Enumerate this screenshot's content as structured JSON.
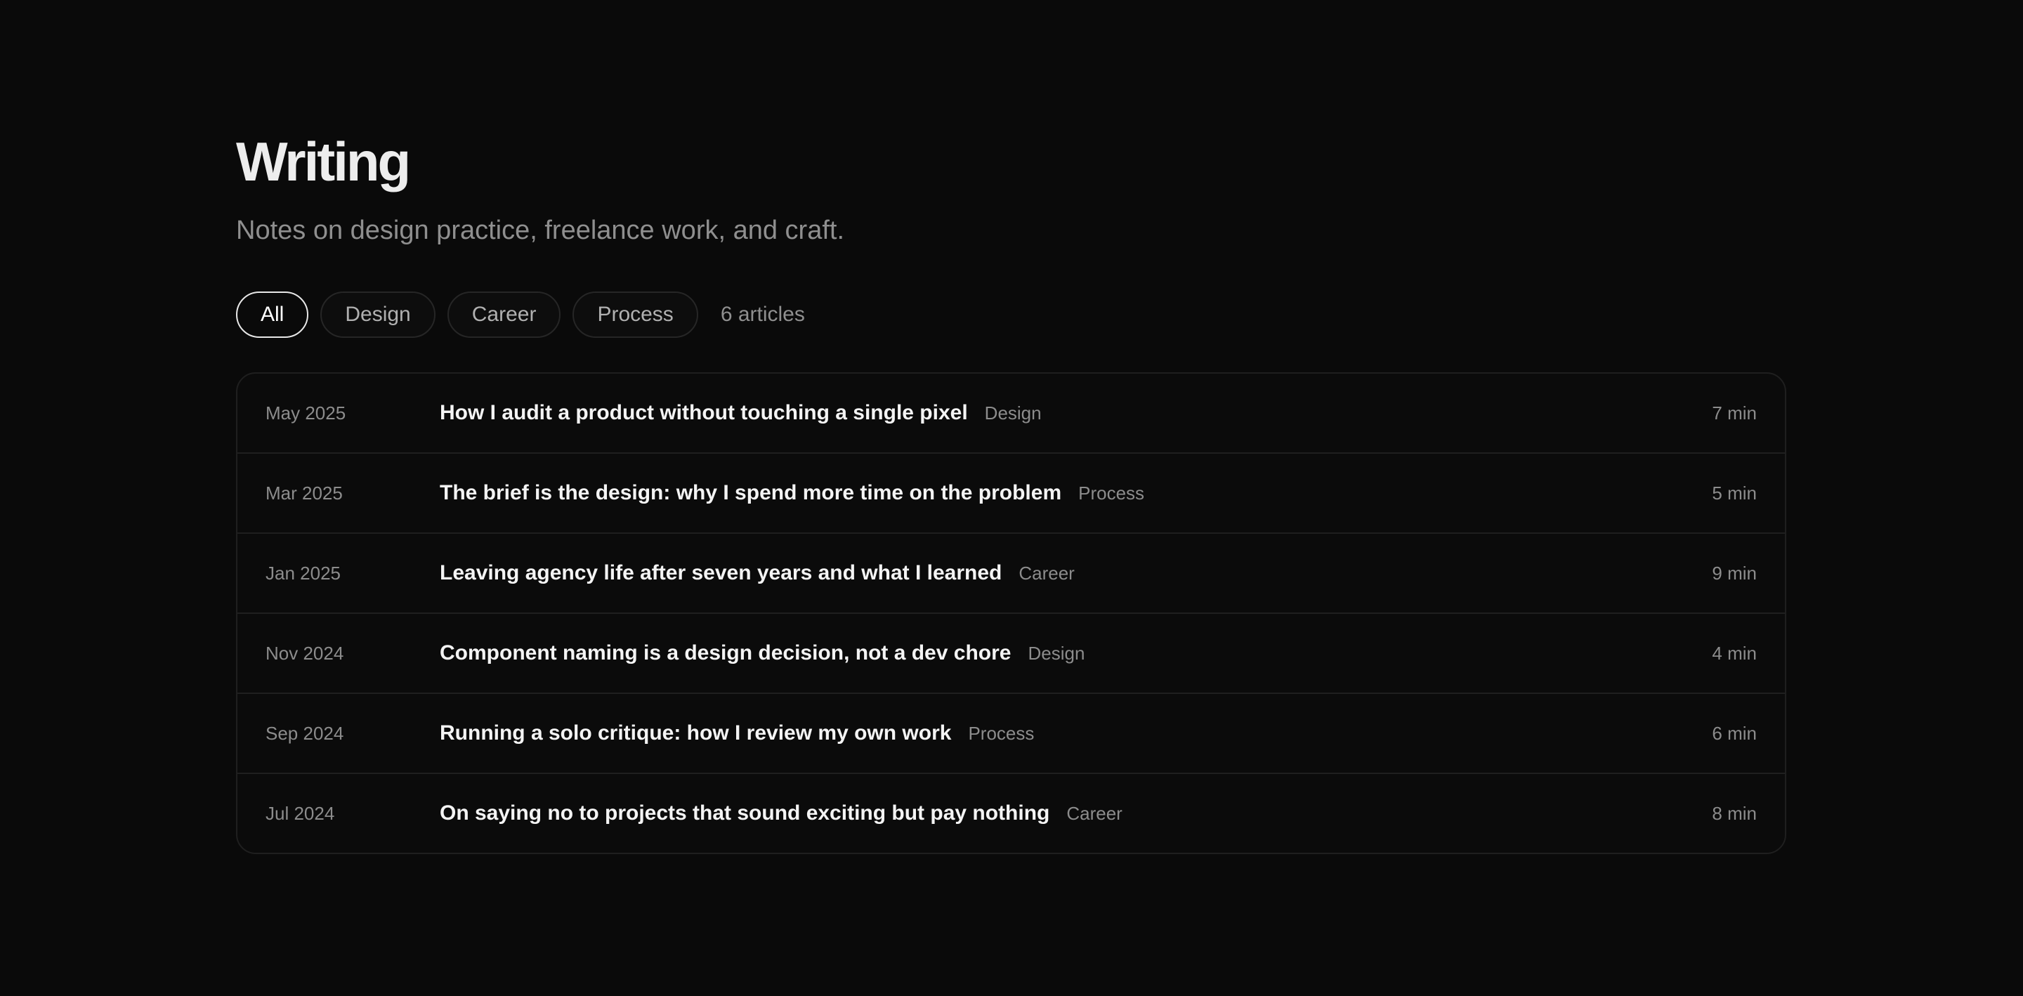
{
  "header": {
    "title": "Writing",
    "subtitle": "Notes on design practice, freelance work, and craft."
  },
  "filters": {
    "items": [
      {
        "label": "All",
        "active": true
      },
      {
        "label": "Design",
        "active": false
      },
      {
        "label": "Career",
        "active": false
      },
      {
        "label": "Process",
        "active": false
      }
    ],
    "count_label": "6 articles"
  },
  "articles": [
    {
      "date": "May 2025",
      "title": "How I audit a product without touching a single pixel",
      "tag": "Design",
      "read_time": "7 min"
    },
    {
      "date": "Mar 2025",
      "title": "The brief is the design: why I spend more time on the problem",
      "tag": "Process",
      "read_time": "5 min"
    },
    {
      "date": "Jan 2025",
      "title": "Leaving agency life after seven years and what I learned",
      "tag": "Career",
      "read_time": "9 min"
    },
    {
      "date": "Nov 2024",
      "title": "Component naming is a design decision, not a dev chore",
      "tag": "Design",
      "read_time": "4 min"
    },
    {
      "date": "Sep 2024",
      "title": "Running a solo critique: how I review my own work",
      "tag": "Process",
      "read_time": "6 min"
    },
    {
      "date": "Jul 2024",
      "title": "On saying no to projects that sound exciting but pay nothing",
      "tag": "Career",
      "read_time": "8 min"
    }
  ],
  "colors": {
    "background": "#0a0a0a",
    "text_primary": "#f4f4f4",
    "text_muted": "#8c8c8c",
    "border": "#1f1f1f"
  }
}
